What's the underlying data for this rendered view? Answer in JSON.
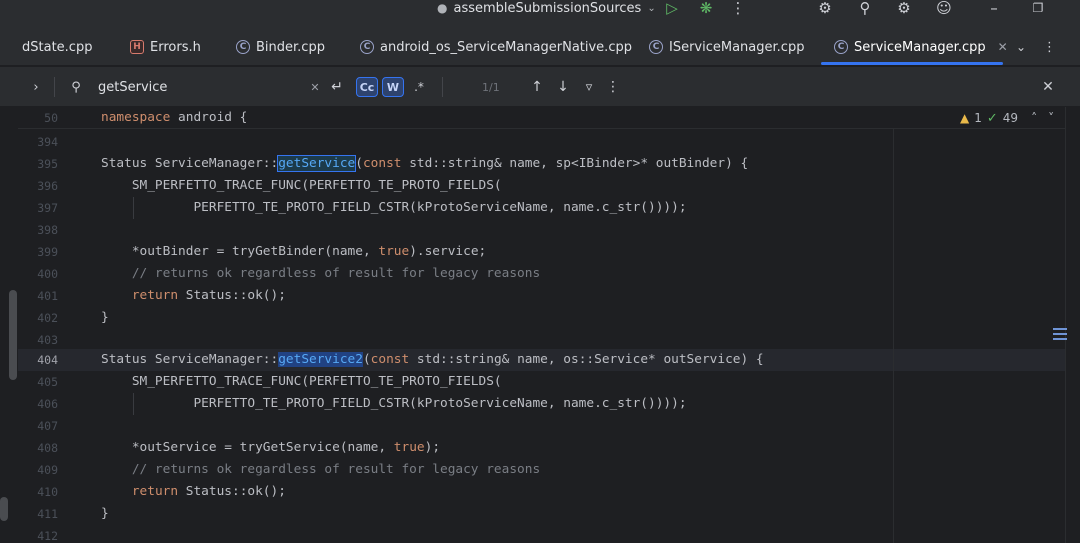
{
  "toolbar": {
    "run_config": "assembleSubmissionSources",
    "icons": [
      "run-icon",
      "debug-icon",
      "more-icon",
      "bug-sync-icon",
      "search-icon",
      "settings-icon",
      "account-icon",
      "minimize-icon",
      "restore-icon"
    ]
  },
  "tabs": [
    {
      "label": "dState.cpp",
      "type": "cpp"
    },
    {
      "label": "Errors.h",
      "type": "h"
    },
    {
      "label": "Binder.cpp",
      "type": "cpp"
    },
    {
      "label": "android_os_ServiceManagerNative.cpp",
      "type": "cpp"
    },
    {
      "label": "IServiceManager.cpp",
      "type": "cpp"
    },
    {
      "label": "ServiceManager.cpp",
      "type": "cpp",
      "active": true
    }
  ],
  "find": {
    "query": "getService",
    "opt_case": "Cc",
    "opt_word": "W",
    "opt_regex": ".*",
    "match_count": "1/1"
  },
  "inspections": {
    "warnings": "1",
    "ok": "49"
  },
  "sticky": {
    "line": "50",
    "kw": "namespace",
    "rest": " android {"
  },
  "lines": [
    {
      "n": "394"
    },
    {
      "n": "395",
      "a": "Status ServiceManager::",
      "b": "getService",
      "c": "(",
      "d": "const",
      "e": " std::string& name, sp<IBinder>* outBinder) {"
    },
    {
      "n": "396",
      "a": "    SM_PERFETTO_TRACE_FUNC(PERFETTO_TE_PROTO_FIELDS("
    },
    {
      "n": "397",
      "a": "            PERFETTO_TE_PROTO_FIELD_CSTR(kProtoServiceName, name.c_str())));"
    },
    {
      "n": "398"
    },
    {
      "n": "399",
      "a": "    *outBinder = tryGetBinder(name, ",
      "b": "true",
      "c": ").service;"
    },
    {
      "n": "400",
      "a": "    // returns ok regardless of result for legacy reasons"
    },
    {
      "n": "401",
      "a": "    ",
      "b": "return",
      "c": " Status::ok();"
    },
    {
      "n": "402",
      "a": "}"
    },
    {
      "n": "403"
    },
    {
      "n": "404",
      "a": "Status ServiceManager::",
      "b": "getService2",
      "c": "(",
      "d": "const",
      "e": " std::string& name, os::Service* outService) {"
    },
    {
      "n": "405",
      "a": "    SM_PERFETTO_TRACE_FUNC(PERFETTO_TE_PROTO_FIELDS("
    },
    {
      "n": "406",
      "a": "            PERFETTO_TE_PROTO_FIELD_CSTR(kProtoServiceName, name.c_str())));"
    },
    {
      "n": "407"
    },
    {
      "n": "408",
      "a": "    *outService = tryGetService(name, ",
      "b": "true",
      "c": ");"
    },
    {
      "n": "409",
      "a": "    // returns ok regardless of result for legacy reasons"
    },
    {
      "n": "410",
      "a": "    ",
      "b": "return",
      "c": " Status::ok();"
    },
    {
      "n": "411",
      "a": "}"
    },
    {
      "n": "412"
    }
  ]
}
